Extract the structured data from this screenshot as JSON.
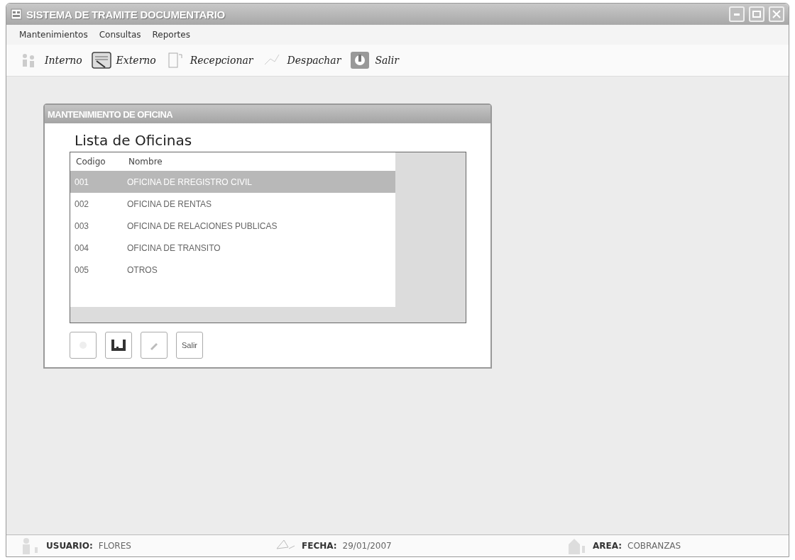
{
  "window": {
    "title": "SISTEMA DE TRAMITE DOCUMENTARIO"
  },
  "menu": [
    "Mantenimientos",
    "Consultas",
    "Reportes"
  ],
  "toolbar": [
    {
      "kind": "interno",
      "label": "Interno"
    },
    {
      "kind": "externo",
      "label": "Externo"
    },
    {
      "kind": "recepcionar",
      "label": "Recepcionar"
    },
    {
      "kind": "despachar",
      "label": "Despachar"
    },
    {
      "kind": "salir",
      "label": "Salir"
    }
  ],
  "dialog": {
    "title": "MANTENIMIENTO DE OFICINA",
    "heading": "Lista de Oficinas",
    "table": {
      "columns": [
        "Codigo",
        "Nombre"
      ],
      "rows": [
        {
          "code": "001",
          "name": "OFICINA DE RREGISTRO CIVIL",
          "selected": true
        },
        {
          "code": "002",
          "name": "OFICINA DE RENTAS",
          "selected": false
        },
        {
          "code": "003",
          "name": "OFICINA DE RELACIONES PUBLICAS",
          "selected": false
        },
        {
          "code": "004",
          "name": "OFICINA DE TRANSITO",
          "selected": false
        },
        {
          "code": "005",
          "name": "OTROS",
          "selected": false
        }
      ]
    },
    "buttons": [
      {
        "kind": "new"
      },
      {
        "kind": "save"
      },
      {
        "kind": "edit"
      },
      {
        "kind": "text",
        "label": "Salir"
      }
    ]
  },
  "status_bar": [
    {
      "kind": "user",
      "label": "USUARIO:",
      "value": "FLORES"
    },
    {
      "kind": "date",
      "label": "FECHA:",
      "value": "29/01/2007"
    },
    {
      "kind": "area",
      "label": "AREA:",
      "value": "COBRANZAS"
    }
  ]
}
